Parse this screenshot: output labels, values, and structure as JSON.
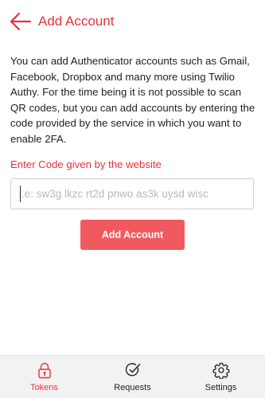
{
  "header": {
    "back_icon": "arrow-left-icon",
    "title": "Add Account"
  },
  "main": {
    "description": "You can add Authenticator accounts such as Gmail, Facebook, Dropbox and many more using Twilio Authy. For the time being it is not possible to scan QR codes, but you can add accounts by entering the code provided by the service in which you want to enable 2FA.",
    "code_label": "Enter Code given by the website",
    "code_input": {
      "value": "",
      "placeholder": "i.e: sw3g lkzc rt2d pnwo as3k uysd wisc"
    },
    "submit_label": "Add Account"
  },
  "tabbar": {
    "active": "tokens",
    "tabs": [
      {
        "id": "tokens",
        "label": "Tokens",
        "icon": "lock-icon"
      },
      {
        "id": "requests",
        "label": "Requests",
        "icon": "check-circle-icon"
      },
      {
        "id": "settings",
        "label": "Settings",
        "icon": "gear-icon"
      }
    ]
  },
  "colors": {
    "accent": "#e5323b",
    "button": "#f05a5f",
    "tabbar_bg": "#f2f2f2"
  }
}
